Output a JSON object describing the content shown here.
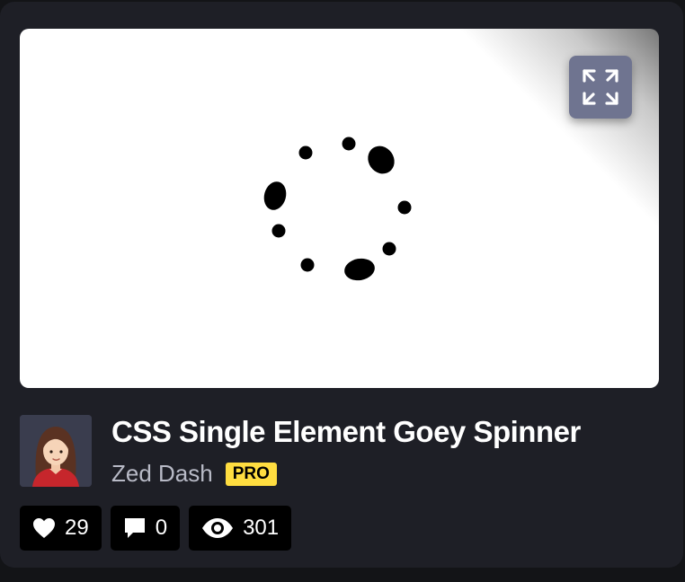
{
  "pen": {
    "title": "CSS Single Element Goey Spinner",
    "author": "Zed Dash",
    "badge": "PRO"
  },
  "preview": {
    "expand_icon": "expand-icon"
  },
  "stats": {
    "likes": "29",
    "comments": "0",
    "views": "301"
  },
  "icons": {
    "likes": "heart-icon",
    "comments": "comment-icon",
    "views": "eye-icon"
  },
  "colors": {
    "card_bg": "#1e1f26",
    "expand_button": "#6f7490",
    "pro_badge": "#ffdd40",
    "stat_bg": "#000000"
  }
}
